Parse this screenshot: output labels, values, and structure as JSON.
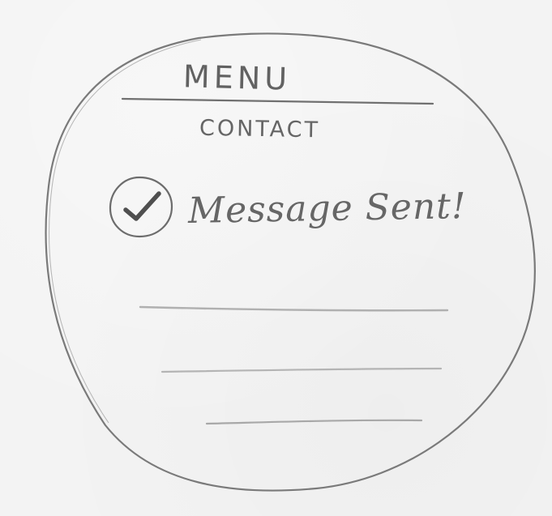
{
  "screen": {
    "menu_label": "MENU",
    "section_title": "CONTACT",
    "status_message": "Message Sent!",
    "status_icon": "check-circle-icon"
  },
  "colors": {
    "paper": "#f3f3f3",
    "pencil": "#5f5f5f",
    "light_pencil": "#b7b7b7"
  }
}
